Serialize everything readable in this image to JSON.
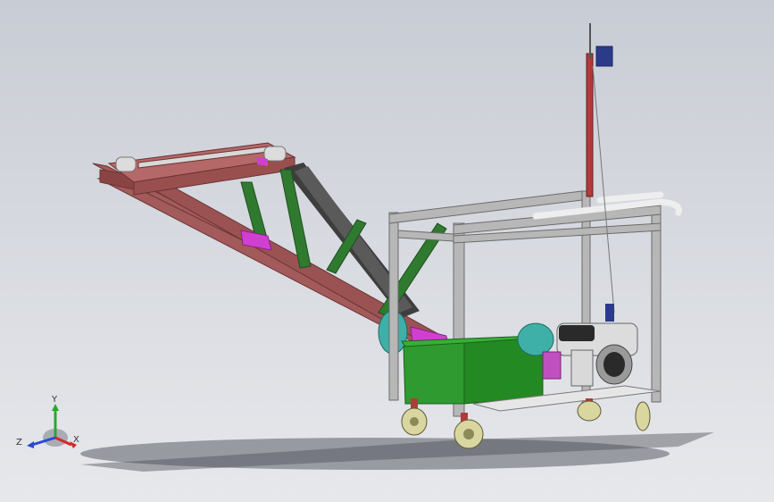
{
  "viewport": {
    "background_top": "#c8ccd4",
    "background_bottom": "#e7e8ec"
  },
  "triad": {
    "x_label": "X",
    "y_label": "Y",
    "z_label": "Z",
    "x_color": "#d12a2a",
    "y_color": "#2aa82a",
    "z_color": "#2a4ad1"
  },
  "model": {
    "frame_color": "#a25a5a",
    "brace_color": "#2f7a2f",
    "bin_color": "#2f9a2f",
    "tower_color": "#b7b7b7",
    "belt_color": "#444444",
    "accent_color": "#d040d0",
    "wheel_color": "#d9d6a0"
  }
}
